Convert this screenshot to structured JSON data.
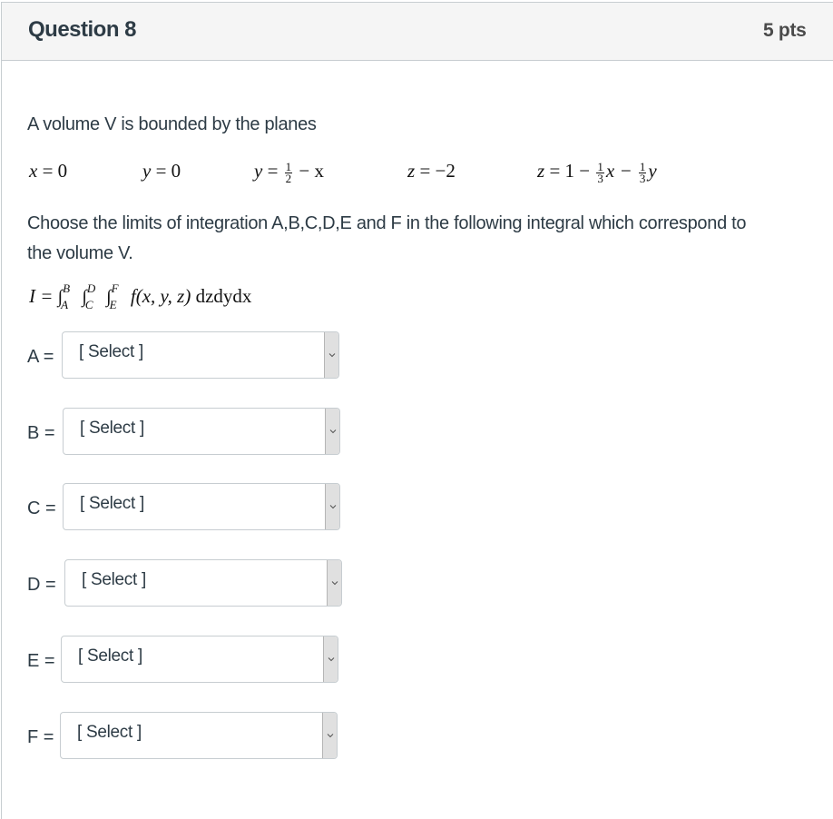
{
  "question": {
    "title": "Question 8",
    "points": "5 pts"
  },
  "intro": "A volume V is bounded by the planes",
  "planes": [
    {
      "lhs": "x",
      "rhs_prefix": "0"
    },
    {
      "lhs": "y",
      "rhs_prefix": "0"
    },
    {
      "lhs": "y",
      "frac_num": "1",
      "frac_den": "2",
      "rhs_suffix": "− x"
    },
    {
      "lhs": "z",
      "rhs_prefix": "−2"
    },
    {
      "lhs": "z",
      "rhs_prefix": "1 −",
      "frac1_num": "1",
      "frac1_den": "3",
      "mid": "x −",
      "frac2_num": "1",
      "frac2_den": "3",
      "tail": "y"
    }
  ],
  "prompt": "Choose the limits of integration A,B,C,D,E and F in the following integral which correspond to the volume V.",
  "integral": {
    "lhs": "I =",
    "limits": [
      {
        "upper": "B",
        "lower": "A"
      },
      {
        "upper": "D",
        "lower": "C"
      },
      {
        "upper": "F",
        "lower": "E"
      }
    ],
    "integrand": "f(x, y, z)",
    "differentials": "dzdydx"
  },
  "selects": [
    {
      "label": "A =",
      "value": "[ Select ]"
    },
    {
      "label": "B =",
      "value": "[ Select ]"
    },
    {
      "label": "C =",
      "value": "[ Select ]"
    },
    {
      "label": "D =",
      "value": "[ Select ]"
    },
    {
      "label": "E =",
      "value": "[ Select ]"
    },
    {
      "label": "F =",
      "value": "[ Select ]"
    }
  ]
}
